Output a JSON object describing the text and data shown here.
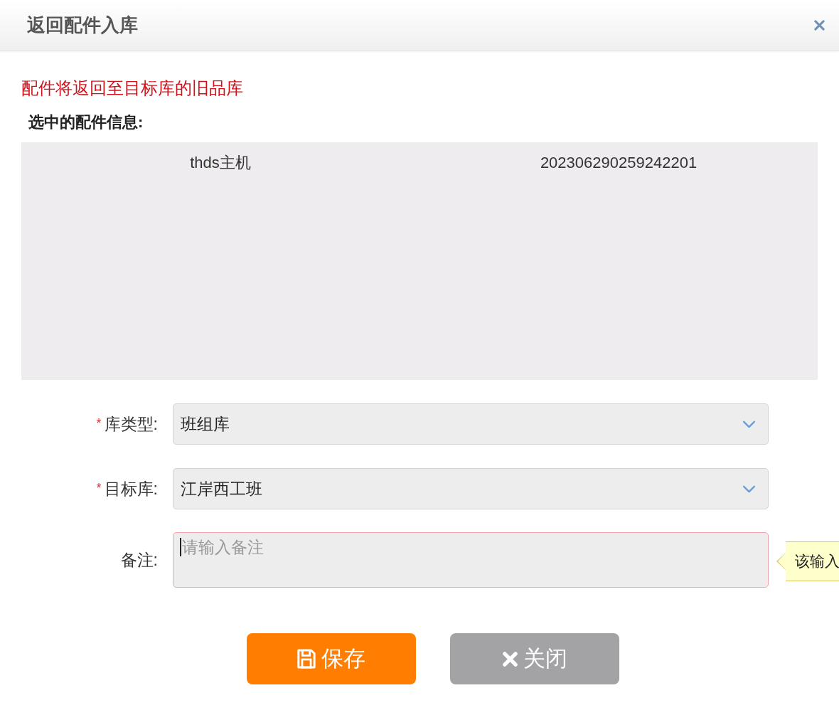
{
  "dialog": {
    "title": "返回配件入库"
  },
  "notice": "配件将返回至目标库的旧品库",
  "selected_parts": {
    "heading": "选中的配件信息:",
    "rows": [
      {
        "column_1": "thds主机",
        "column_2": "202306290259242201"
      }
    ]
  },
  "form": {
    "required_mark": "*",
    "fields": [
      {
        "kind": "select",
        "label": "库类型:",
        "required": true,
        "value": "班组库"
      },
      {
        "kind": "select",
        "label": "目标库:",
        "required": true,
        "value": "江岸西工班"
      },
      {
        "kind": "textarea",
        "label": "备注:",
        "required": false,
        "placeholder": "请输入备注",
        "invalid": true,
        "focused": true,
        "tooltip": "该输入"
      }
    ]
  },
  "buttons": [
    {
      "kind": "save",
      "label": "保存"
    },
    {
      "kind": "close",
      "label": "关闭"
    }
  ]
}
